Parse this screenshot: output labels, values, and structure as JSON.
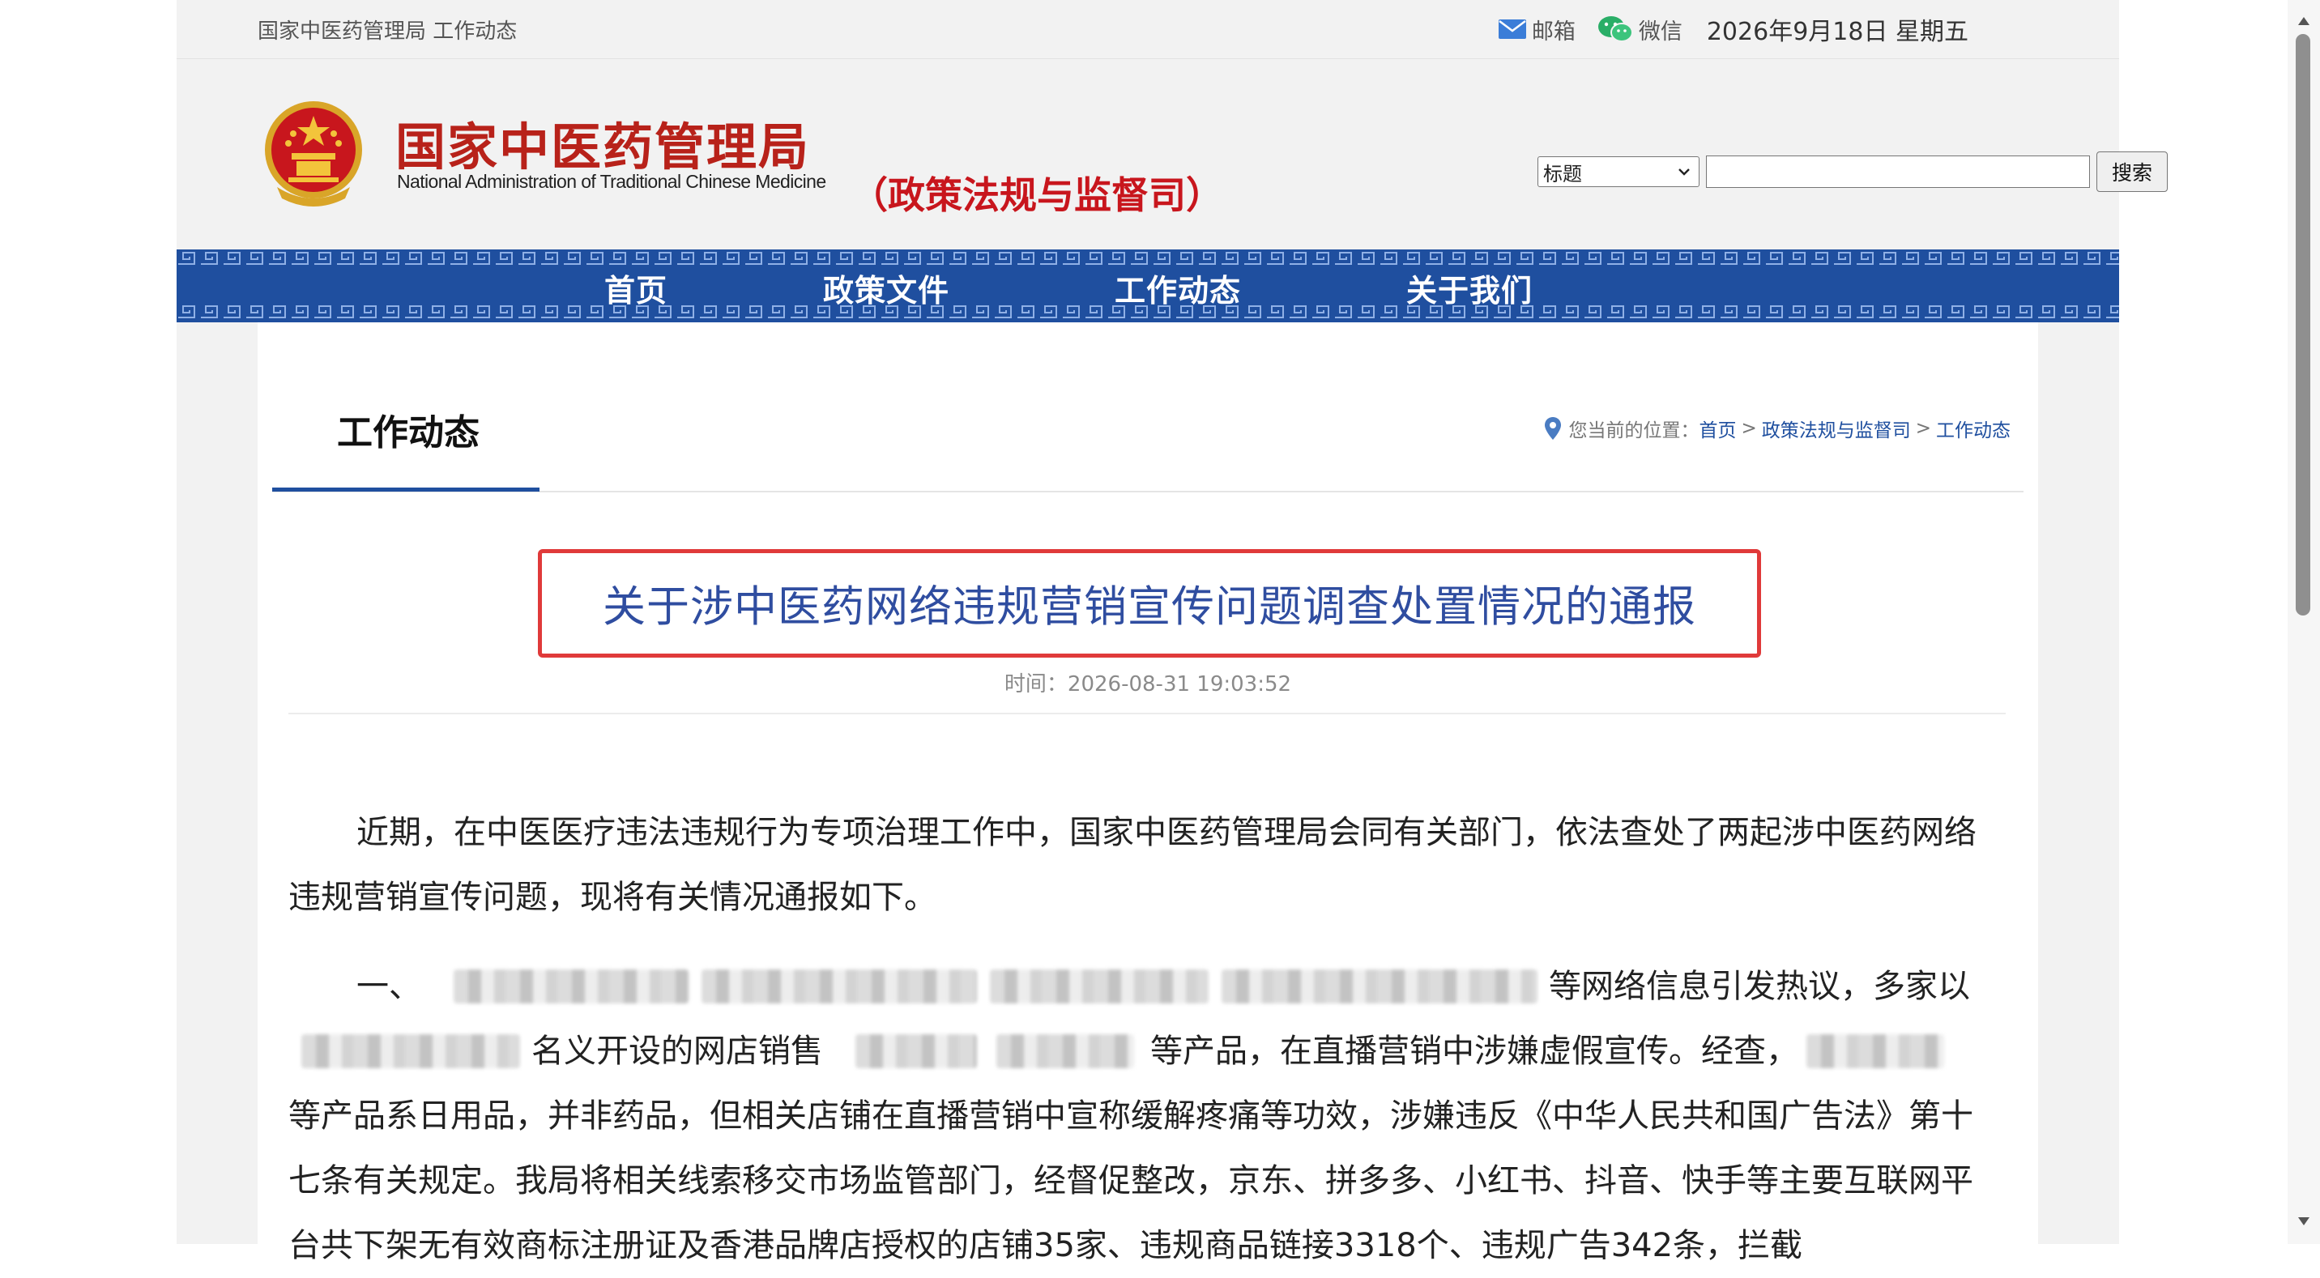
{
  "topbar": {
    "site_label": "国家中医药管理局 工作动态",
    "mail_label": "邮箱",
    "wechat_label": "微信",
    "date": "2026年9月18日 星期五"
  },
  "header": {
    "logo_cn": "国家中医药管理局",
    "logo_en": "National Administration of Traditional Chinese Medicine",
    "dept": "（政策法规与监督司）"
  },
  "search": {
    "select_value": "标题",
    "input_value": "",
    "button_label": "搜索"
  },
  "nav": {
    "items": [
      {
        "label": "首页"
      },
      {
        "label": "政策文件"
      },
      {
        "label": "工作动态"
      },
      {
        "label": "关于我们"
      }
    ]
  },
  "section": {
    "title": "工作动态"
  },
  "breadcrumb": {
    "prefix": "您当前的位置：",
    "items": [
      "首页",
      "政策法规与监督司",
      "工作动态"
    ],
    "separator": ">"
  },
  "article": {
    "title": "关于涉中医药网络违规营销宣传问题调查处置情况的通报",
    "time": "时间：2026-08-31 19:03:52",
    "p1": "近期，在中医医疗违法违规行为专项治理工作中，国家中医药管理局会同有关部门，依法查处了两起涉中医药网络违规营销宣传问题，现将有关情况通报如下。",
    "p2_lead": "一、",
    "p2_a": "等网络信息引发热议，多家以",
    "p2_b": "名义开设的网店销售",
    "p2_c": "等产品，在直播营销中涉嫌虚假宣传。经查，",
    "p2_d": "等产品系日用品，并非药品，但相关店铺在直播营销中宣称缓解疼痛等功效，涉嫌违反《中华人民共和国广告法》第十七条有关规定。我局将相关线索移交市场监管部门，经督促整改，京东、拼多多、小红书、抖音、快手等主要互联网平台共下架无有效商标注册证及香港品牌店授权的店铺35家、违规商品链接3318个、违规广告342条，拦截"
  },
  "colors": {
    "nav_blue": "#1f4f9f",
    "logo_red": "#b8221a",
    "highlight_border": "#e03a3a",
    "title_blue": "#2f4da0"
  }
}
